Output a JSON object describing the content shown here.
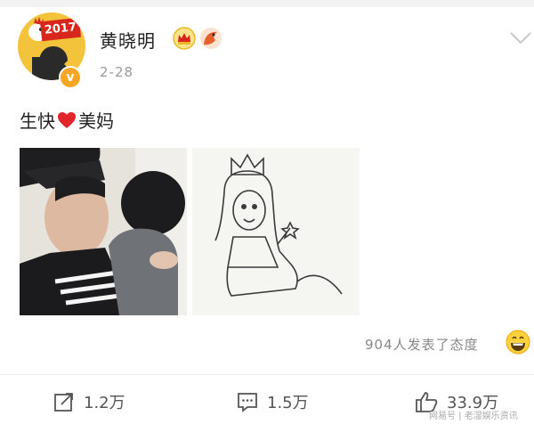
{
  "post": {
    "author": "黄晓明",
    "date": "2-28",
    "text_before": "生快",
    "text_after": "美妈",
    "avatar": {
      "flag_text": "2017",
      "verified_mark": "v",
      "accent": "#f3c33b"
    },
    "badges": [
      "crown-badge-icon",
      "fox-badge-icon"
    ],
    "images": [
      {
        "name": "photo-father-and-child"
      },
      {
        "name": "photo-princess-drawing"
      }
    ],
    "reactions_text": "904人发表了态度",
    "reaction_emoji": "grinning-face-icon"
  },
  "actions": {
    "share_count": "1.2万",
    "comment_count": "1.5万",
    "like_count": "33.9万"
  },
  "watermark": "网易号 | 老湿娱乐资讯",
  "colors": {
    "heart": "#e0252b",
    "text": "#222222",
    "muted": "#999999",
    "icon": "#555555"
  }
}
